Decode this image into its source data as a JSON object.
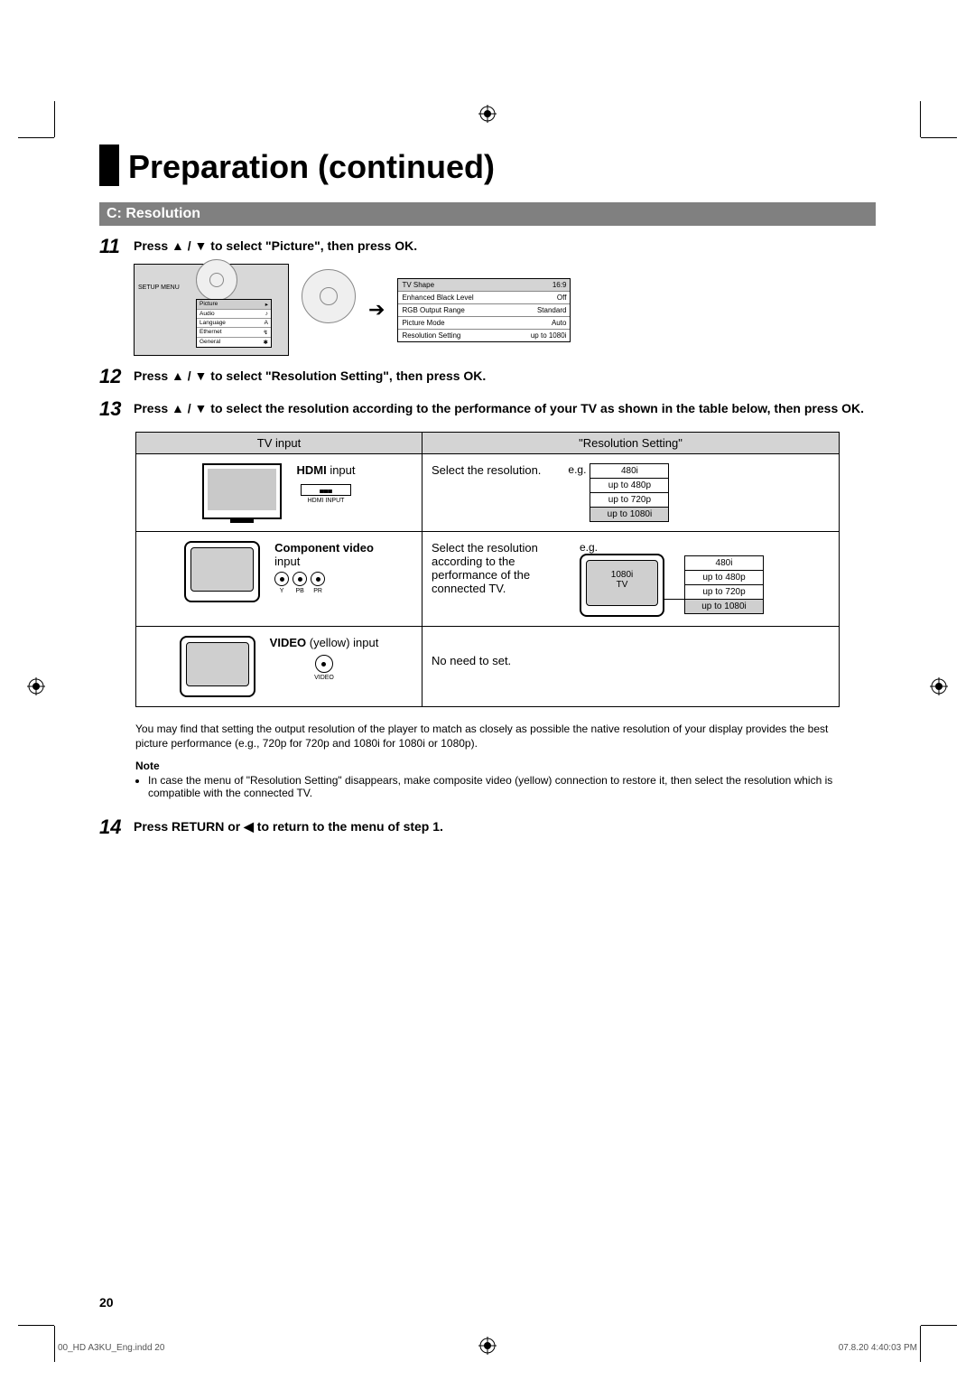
{
  "title": "Preparation (continued)",
  "section": "C: Resolution",
  "steps": {
    "s11": {
      "num": "11",
      "text": "Press ▲ / ▼ to select \"Picture\", then press OK."
    },
    "s12": {
      "num": "12",
      "text": "Press ▲ / ▼ to select \"Resolution Setting\", then press OK."
    },
    "s13": {
      "num": "13",
      "text": "Press ▲ / ▼ to select the resolution according to the performance of your TV as shown in the table below, then press OK."
    },
    "s14": {
      "num": "14",
      "text": "Press RETURN or ◀ to return to the menu of step 1."
    }
  },
  "setup_menu": {
    "label": "SETUP MENU",
    "items": [
      {
        "name": "Picture",
        "selected": true
      },
      {
        "name": "Audio"
      },
      {
        "name": "Language"
      },
      {
        "name": "Ethernet"
      },
      {
        "name": "General"
      }
    ]
  },
  "picture_menu": [
    {
      "name": "TV Shape",
      "value": "16:9",
      "selected": true
    },
    {
      "name": "Enhanced Black Level",
      "value": "Off"
    },
    {
      "name": "RGB Output Range",
      "value": "Standard"
    },
    {
      "name": "Picture Mode",
      "value": "Auto"
    },
    {
      "name": "Resolution Setting",
      "value": "up to 1080i"
    }
  ],
  "table": {
    "hdr_left": "TV input",
    "hdr_right": "\"Resolution Setting\"",
    "row1": {
      "bold": "HDMI",
      "rest": " input",
      "port_label": "HDMI INPUT",
      "right_text": "Select the resolution.",
      "eg": "e.g."
    },
    "row2": {
      "bold": "Component video",
      "rest": "input",
      "rca_y": "Y",
      "rca_pb": "PB",
      "rca_pr": "PR",
      "right_text": "Select the resolution according to the performance of the connected TV.",
      "eg": "e.g.",
      "tv_label": "1080i\nTV"
    },
    "row3": {
      "bold": "VIDEO",
      "rest": " (yellow) input",
      "lbl": "VIDEO",
      "right_text": "No need to set."
    },
    "resolutions": [
      "480i",
      "up to 480p",
      "up to 720p",
      "up to 1080i"
    ]
  },
  "paragraph": "You may find that setting the output resolution of the player to match as closely as possible the native resolution of your display provides the best picture performance (e.g., 720p for 720p and 1080i for 1080i or 1080p).",
  "note_label": "Note",
  "note_item": "In case the menu of \"Resolution Setting\" disappears, make composite video (yellow) connection to restore it, then select the resolution which is compatible with the connected TV.",
  "page_number": "20",
  "footer_left": "00_HD A3KU_Eng.indd   20",
  "footer_right": "07.8.20   4:40:03 PM"
}
